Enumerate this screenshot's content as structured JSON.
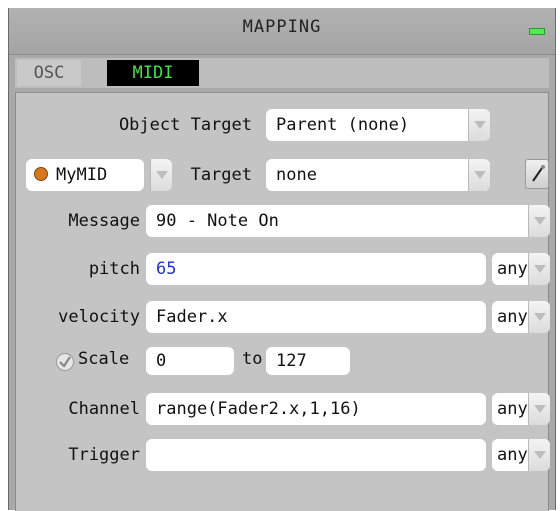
{
  "window": {
    "title": "MAPPING"
  },
  "tabs": [
    {
      "label": "OSC",
      "active": false
    },
    {
      "label": "MIDI",
      "active": true
    }
  ],
  "object_target": {
    "label": "Object Target",
    "value": "Parent (none)"
  },
  "midi_device": {
    "value": "MyMID",
    "status_color": "#d9771f"
  },
  "target": {
    "label": "Target",
    "value": "none"
  },
  "message": {
    "label": "Message",
    "value": "90 - Note On"
  },
  "pitch": {
    "label": "pitch",
    "value": "65",
    "mode": "any"
  },
  "velocity": {
    "label": "velocity",
    "value": "Fader.x",
    "mode": "any"
  },
  "scale": {
    "label": "Scale",
    "checked": true,
    "from": "0",
    "to_label": "to",
    "to": "127"
  },
  "channel": {
    "label": "Channel",
    "value": "range(Fader2.x,1,16)",
    "mode": "any"
  },
  "trigger": {
    "label": "Trigger",
    "value": "",
    "mode": "any"
  },
  "icons": {
    "picker": "wand-picker-icon",
    "dropdown": "chevron-down-icon"
  }
}
